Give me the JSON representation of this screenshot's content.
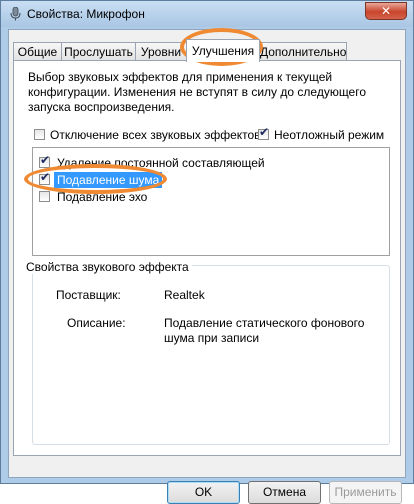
{
  "window": {
    "title": "Свойства: Микрофон",
    "close_label": "✕"
  },
  "tabs": [
    {
      "label": "Общие"
    },
    {
      "label": "Прослушать"
    },
    {
      "label": "Уровни"
    },
    {
      "label": "Улучшения",
      "active": true
    },
    {
      "label": "Дополнительно"
    }
  ],
  "description": "Выбор звуковых эффектов для применения к текущей конфигурации. Изменения не вступят в силу до следующего запуска воспроизведения.",
  "options": {
    "disable_all": {
      "label": "Отключение всех звуковых эффектов",
      "checked": false
    },
    "immediate_mode": {
      "label": "Неотложный режим",
      "checked": true
    }
  },
  "effects": [
    {
      "label": "Удаление постоянной составляющей",
      "checked": true,
      "selected": false
    },
    {
      "label": "Подавление шума",
      "checked": true,
      "selected": true
    },
    {
      "label": "Подавление эхо",
      "checked": false,
      "selected": false
    }
  ],
  "properties": {
    "title": "Свойства звукового эффекта",
    "provider_key": "Поставщик:",
    "provider_value": "Realtek",
    "desc_key": "Описание:",
    "desc_value": "Подавление статического фонового шума при записи"
  },
  "buttons": {
    "ok": "OK",
    "cancel": "Отмена",
    "apply": "Применить"
  },
  "colors": {
    "highlight_oval": "#f08a32",
    "selection": "#3399ff"
  }
}
